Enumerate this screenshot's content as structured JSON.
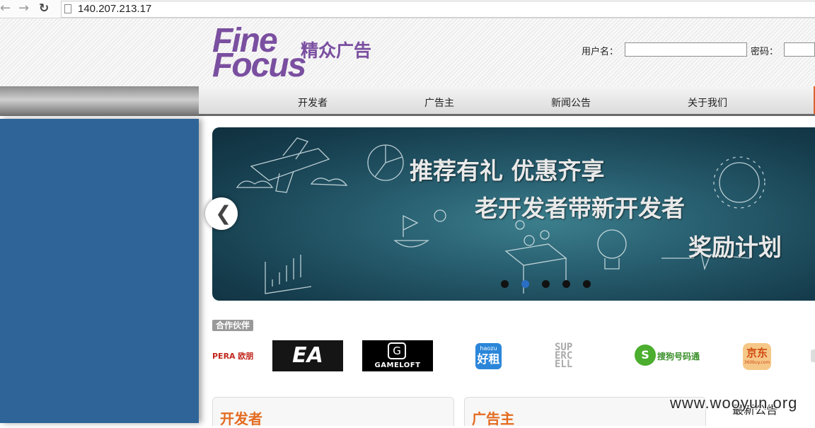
{
  "browser": {
    "url": "140.207.213.17",
    "back_icon": "back-arrow-icon",
    "forward_icon": "forward-arrow-icon",
    "reload_icon": "reload-icon"
  },
  "header": {
    "logo_line1": "Fine",
    "logo_line2": "Focus",
    "logo_cn": "精众广告",
    "username_label": "用户名：",
    "password_label": "密码："
  },
  "nav": {
    "items": [
      "开发者",
      "广告主",
      "新闻公告",
      "关于我们"
    ]
  },
  "banner": {
    "line1": "推荐有礼 优惠齐享",
    "line2": "老开发者带新开发者",
    "line3": "奖励计划",
    "active_slide": 2,
    "slide_count": 5
  },
  "partners": {
    "label": "合作伙伴",
    "opera": "PERA 欧朋",
    "ea": "EA",
    "gameloft": "GAMELOFT",
    "gameloft_mark": "G",
    "haozu_small": "haozu",
    "haozu_big": "好租",
    "supercell": "SUP ERC ELL",
    "sogou_mark": "S",
    "sogou": "搜狗号码通",
    "jd_big": "京东",
    "jd_small": "360buy.com"
  },
  "panels": {
    "developer": "开发者",
    "advertiser": "广告主",
    "news": "最新公告"
  },
  "watermark": "www.wooyun.org",
  "colors": {
    "brand_purple": "#7a4fa0",
    "sidebar_blue": "#2e6497",
    "accent_orange": "#e46b1f"
  }
}
